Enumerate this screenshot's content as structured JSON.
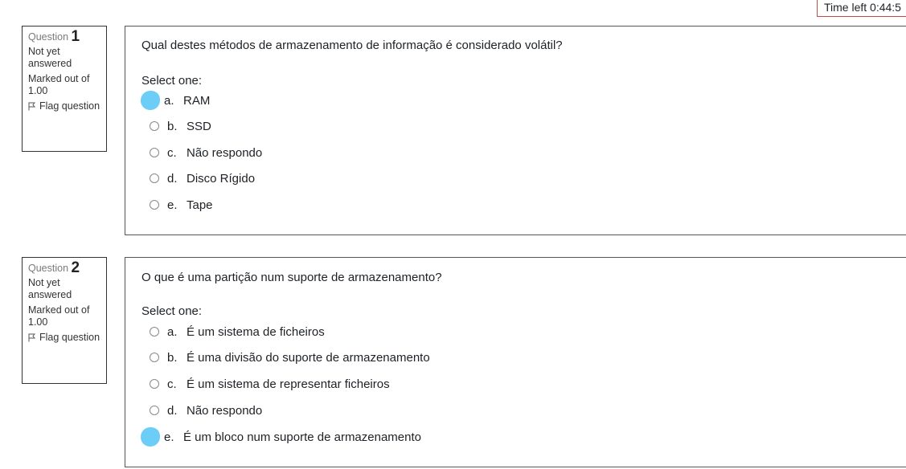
{
  "timer": {
    "text": "Time left 0:44:5"
  },
  "questions": [
    {
      "label": "Question",
      "number": "1",
      "state": "Not yet answered",
      "marked": "Marked out of 1.00",
      "flag": "Flag question",
      "text": "Qual destes métodos de armazenamento de informação é considerado volátil?",
      "prompt": "Select one:",
      "answers": [
        {
          "letter": "a.",
          "text": "RAM",
          "selected": true
        },
        {
          "letter": "b.",
          "text": "SSD",
          "selected": false
        },
        {
          "letter": "c.",
          "text": "Não respondo",
          "selected": false
        },
        {
          "letter": "d.",
          "text": "Disco Rígido",
          "selected": false
        },
        {
          "letter": "e.",
          "text": "Tape",
          "selected": false
        }
      ]
    },
    {
      "label": "Question",
      "number": "2",
      "state": "Not yet answered",
      "marked": "Marked out of 1.00",
      "flag": "Flag question",
      "text": "O que é uma partição num suporte de armazenamento?",
      "prompt": "Select one:",
      "answers": [
        {
          "letter": "a.",
          "text": "É um sistema de ficheiros",
          "selected": false
        },
        {
          "letter": "b.",
          "text": "É uma divisão do suporte de armazenamento",
          "selected": false
        },
        {
          "letter": "c.",
          "text": "É um sistema de representar ficheiros",
          "selected": false
        },
        {
          "letter": "d.",
          "text": "Não respondo",
          "selected": false
        },
        {
          "letter": "e.",
          "text": "É um bloco num suporte de armazenamento",
          "selected": true
        }
      ]
    }
  ],
  "colors": {
    "selected_marker": "#6ccdf7",
    "timer_border": "#c44a4a"
  }
}
